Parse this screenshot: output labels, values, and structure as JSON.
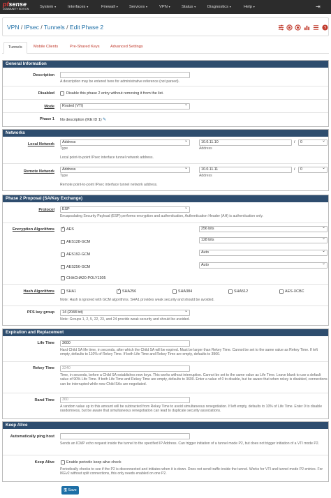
{
  "brand": {
    "name_a": "pf",
    "name_b": "sense",
    "edition": "COMMUNITY EDITION"
  },
  "menu": [
    "System",
    "Interfaces",
    "Firewall",
    "Services",
    "VPN",
    "Status",
    "Diagnostics",
    "Help"
  ],
  "breadcrumb": {
    "vpn": "VPN",
    "ipsec": "IPsec",
    "tunnels": "Tunnels",
    "current": "Edit Phase 2",
    "sep": "/"
  },
  "header_icons": [
    "sliders-icon",
    "stop-circle-icon",
    "status-icon",
    "bar-chart-icon",
    "list-icon",
    "help-icon"
  ],
  "tabs": [
    "Tunnels",
    "Mobile Clients",
    "Pre-Shared Keys",
    "Advanced Settings"
  ],
  "general": {
    "title": "General Information",
    "description_label": "Description",
    "description_value": "",
    "description_help": "A description may be entered here for administrative reference (not parsed).",
    "disabled_label": "Disabled",
    "disabled_text": "Disable this phase 2 entry without removing it from the list.",
    "mode_label": "Mode",
    "mode_value": "Routed (VTI)",
    "phase1_label": "Phase 1",
    "phase1_value": "No description (IKE ID 1)"
  },
  "networks": {
    "title": "Networks",
    "local_label": "Local Network",
    "local_type": "Address",
    "local_addr": "10.0.11.10",
    "local_mask": "0",
    "remote_label": "Remote Network",
    "remote_type": "Address",
    "remote_addr": "10.0.11.11",
    "remote_mask": "0",
    "type_caption": "Type",
    "address_caption": "Address",
    "slash": "/",
    "local_help": "Local point-to-point IPsec interface tunnel network address.",
    "remote_help": "Remote point-to-point IPsec interface tunnel network address."
  },
  "proposal": {
    "title": "Phase 2 Proposal (SA/Key Exchange)",
    "protocol_label": "Protocol",
    "protocol_value": "ESP",
    "protocol_help": "Encapsulating Security Payload (ESP) performs encryption and authentication, Authentication Header (AH) is authentication only.",
    "enc_label": "Encryption Algorithms",
    "enc": [
      {
        "name": "AES",
        "checked": true,
        "key": "256 bits"
      },
      {
        "name": "AES128-GCM",
        "checked": false,
        "key": "128 bits"
      },
      {
        "name": "AES192-GCM",
        "checked": false,
        "key": "Auto"
      },
      {
        "name": "AES256-GCM",
        "checked": false,
        "key": "Auto"
      },
      {
        "name": "CHACHA20-POLY1305",
        "checked": false,
        "key": ""
      }
    ],
    "hash_label": "Hash Algorithms",
    "hash": [
      {
        "name": "SHA1",
        "checked": false
      },
      {
        "name": "SHA256",
        "checked": true
      },
      {
        "name": "SHA384",
        "checked": false
      },
      {
        "name": "SHA512",
        "checked": false
      },
      {
        "name": "AES-XCBC",
        "checked": false
      }
    ],
    "hash_help": "Note: Hash is ignored with GCM algorithms. SHA1 provides weak security and should be avoided.",
    "pfs_label": "PFS key group",
    "pfs_value": "14 (2048 bit)",
    "pfs_help": "Note: Groups 1, 2, 5, 22, 23, and 24 provide weak security and should be avoided."
  },
  "expiration": {
    "title": "Expiration and Replacement",
    "life_label": "Life Time",
    "life_value": "3600",
    "life_help": "Hard Child SA life time, in seconds, after which the Child SA will be expired. Must be larger than Rekey Time. Cannot be set to the same value as Rekey Time. If left empty, defaults to 110% of Rekey Time. If both Life Time and Rekey Time are empty, defaults to 3960.",
    "rekey_label": "Rekey Time",
    "rekey_value": "3240",
    "rekey_help": "Time, in seconds, before a Child SA establishes new keys. This works without interruption. Cannot be set to the same value as Life Time. Leave blank to use a default value of 90% Life Time. If both Life Time and Rekey Time are empty, defaults to 3600. Enter a value of 0 to disable, but be aware that when rekey is disabled, connections can be interrupted while new Child SAs are negotiated.",
    "rand_label": "Rand Time",
    "rand_value": "360",
    "rand_help": "A random value up to this amount will be subtracted from Rekey Time to avoid simultaneous renegotiation. If left empty, defaults to 10% of Life Time. Enter 0 to disable randomness, but be aware that simultaneous renegotiation can lead to duplicate security associations."
  },
  "keepalive": {
    "title": "Keep Alive",
    "ping_label": "Automatically ping host",
    "ping_value": "",
    "ping_help": "Sends an ICMP echo request inside the tunnel to the specified IP Address. Can trigger initiation of a tunnel mode P2, but does not trigger initiation of a VTI mode P2.",
    "ka_label": "Keep Alive",
    "ka_text": "Enable periodic keep alive check",
    "ka_help": "Periodically checks to see if the P2 is disconnected and initiates when it is down. Does not send traffic inside the tunnel. Works for VTI and tunnel mode P2 entries. For IKEv2 without split connections, this only needs enabled on one P2."
  },
  "save_label": "Save"
}
